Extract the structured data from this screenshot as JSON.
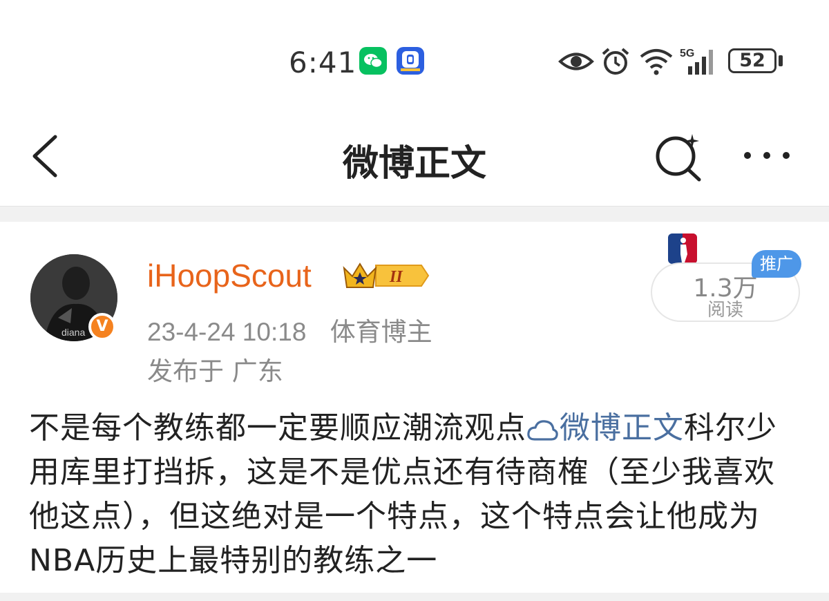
{
  "status_bar": {
    "time": "6:41",
    "network": "5G",
    "battery": "52",
    "icons": [
      "wechat-icon",
      "app-notification-icon",
      "eye-icon",
      "alarm-icon",
      "wifi-icon",
      "signal-icon",
      "battery-icon"
    ]
  },
  "nav": {
    "title": "微博正文",
    "back_icon": "chevron-left-icon",
    "search_icon": "search-icon",
    "more_icon": "more-icon"
  },
  "post": {
    "username": "iHoopScout",
    "badge": "II",
    "verified": "V",
    "timestamp": "23-4-24 10:18",
    "category": "体育博主",
    "location": "发布于 广东",
    "reads": "1.3万",
    "reads_label": "阅读",
    "promo_tag": "推广",
    "body_intro": "不是每个教练都一定要顺应潮流观点",
    "topic_link": "微博正文",
    "body_rest": "科尔少用库里打挡拆，这是不是优点还有待商榷（至少我喜欢他这点），但这绝对是一个特点，这个特点会让他成为NBA历史上最特别的教练之一"
  },
  "colors": {
    "username": "#e8641b",
    "link": "#4a6fa0",
    "promo": "#4e97e8",
    "verified": "#f58220"
  }
}
